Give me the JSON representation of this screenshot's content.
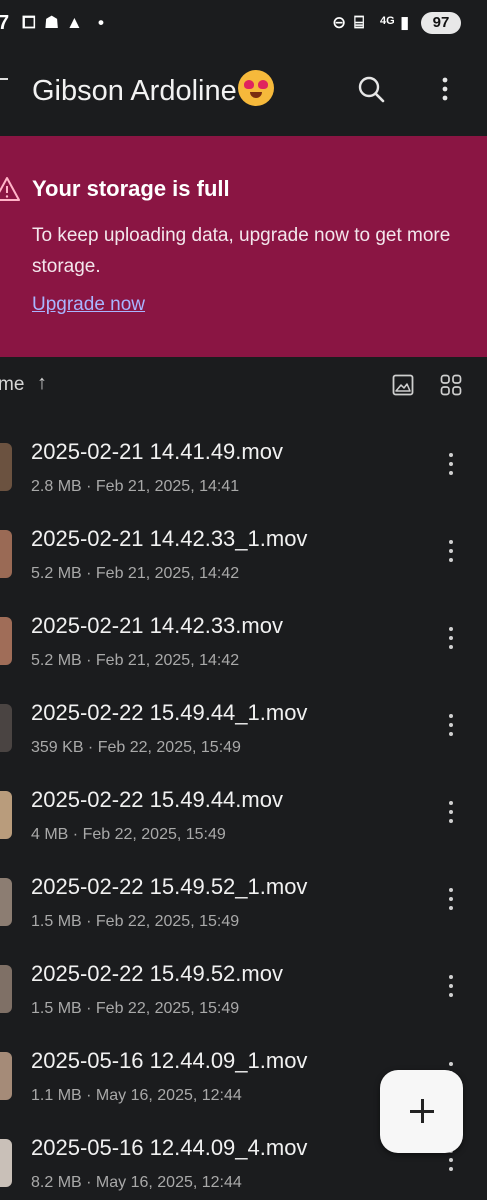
{
  "status_bar": {
    "time": "7",
    "battery": "97",
    "network": "4G"
  },
  "app_bar": {
    "title": "Gibson Ardoline"
  },
  "banner": {
    "title": "Your storage is full",
    "message": "To keep uploading data, upgrade now to get more storage.",
    "link": "Upgrade now",
    "color": "#8a1543"
  },
  "sort": {
    "label": "me",
    "direction": "↑"
  },
  "files": [
    {
      "name": "2025-02-21 14.41.49.mov",
      "meta": "2.8 MB · Feb 21, 2025, 14:41",
      "thumb_color": "#6b5240"
    },
    {
      "name": "2025-02-21 14.42.33_1.mov",
      "meta": "5.2 MB · Feb 21, 2025, 14:42",
      "thumb_color": "#9a6a55"
    },
    {
      "name": "2025-02-21 14.42.33.mov",
      "meta": "5.2 MB · Feb 21, 2025, 14:42",
      "thumb_color": "#a06d58"
    },
    {
      "name": "2025-02-22 15.49.44_1.mov",
      "meta": "359 KB · Feb 22, 2025, 15:49",
      "thumb_color": "#4a4442"
    },
    {
      "name": "2025-02-22 15.49.44.mov",
      "meta": "4 MB · Feb 22, 2025, 15:49",
      "thumb_color": "#b99c7c"
    },
    {
      "name": "2025-02-22 15.49.52_1.mov",
      "meta": "1.5 MB · Feb 22, 2025, 15:49",
      "thumb_color": "#8c7d72"
    },
    {
      "name": "2025-02-22 15.49.52.mov",
      "meta": "1.5 MB · Feb 22, 2025, 15:49",
      "thumb_color": "#7f7066"
    },
    {
      "name": "2025-05-16 12.44.09_1.mov",
      "meta": "1.1 MB · May 16, 2025, 12:44",
      "thumb_color": "#a58b78"
    },
    {
      "name": "2025-05-16 12.44.09_4.mov",
      "meta": "8.2 MB · May 16, 2025, 12:44",
      "thumb_color": "#c9c0b8"
    }
  ],
  "fab": {
    "icon": "plus-icon"
  }
}
